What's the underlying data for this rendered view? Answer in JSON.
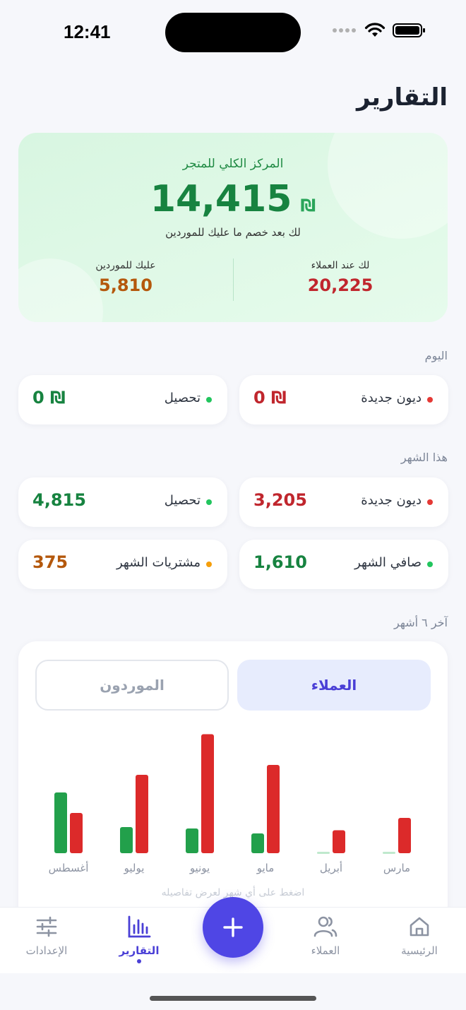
{
  "status": {
    "time": "12:41"
  },
  "page": {
    "title": "التقارير"
  },
  "hero": {
    "label": "المركز الكلي للمتجر",
    "amount": "14,415",
    "currency": "₪",
    "subtitle": "لك بعد خصم ما عليك للموردين",
    "receivable": {
      "label": "لك عند العملاء",
      "value": "20,225"
    },
    "payable": {
      "label": "عليك للموردين",
      "value": "5,810"
    }
  },
  "today": {
    "title": "اليوم",
    "new_debts": {
      "label": "ديون جديدة",
      "value": "0 ₪"
    },
    "collection": {
      "label": "تحصيل",
      "value": "0 ₪"
    }
  },
  "month": {
    "title": "هذا الشهر",
    "new_debts": {
      "label": "ديون جديدة",
      "value": "3,205"
    },
    "collection": {
      "label": "تحصيل",
      "value": "4,815"
    },
    "net": {
      "label": "صافي الشهر",
      "value": "1,610"
    },
    "purchases": {
      "label": "مشتريات الشهر",
      "value": "375"
    }
  },
  "last_six": {
    "title": "آخر ٦ أشهر",
    "segment_customers": "العملاء",
    "segment_suppliers": "الموردون",
    "hint": "اضغط على أي شهر لعرض تفاصيله"
  },
  "chart_data": {
    "type": "bar",
    "categories": [
      "مارس",
      "أبريل",
      "مايو",
      "يونيو",
      "يوليو",
      "أغسطس"
    ],
    "series": [
      {
        "color": "#22a04b",
        "values": [
          0,
          0,
          560,
          700,
          740,
          1720
        ]
      },
      {
        "color": "#dc2a2a",
        "values": [
          1000,
          650,
          2500,
          3370,
          2220,
          1140
        ]
      }
    ]
  },
  "tabs": {
    "home": "الرئيسية",
    "customers": "العملاء",
    "reports": "التقارير",
    "settings": "الإعدادات"
  },
  "colors": {
    "accent": "#4f46e5",
    "green": "#178340",
    "red": "#c0262d",
    "orange": "#b4580c"
  }
}
